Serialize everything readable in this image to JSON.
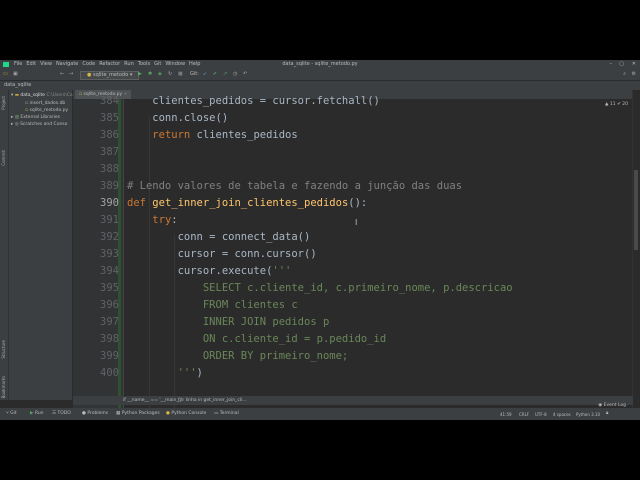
{
  "window": {
    "title": "data_sqlite - sqlite_metodo.py"
  },
  "menu": [
    "File",
    "Edit",
    "View",
    "Navigate",
    "Code",
    "Refactor",
    "Run",
    "Tools",
    "Git",
    "Window",
    "Help"
  ],
  "toolbar": {
    "run_config": "sqlite_metodo",
    "git_label": "Git:"
  },
  "navbar": {
    "project": "data_sqlite"
  },
  "left_tools": {
    "project": "Project",
    "commit": "Commit",
    "structure": "Structure",
    "bookmarks": "Bookmarks"
  },
  "project_tree": {
    "root": "data_sqlite",
    "root_path": "C:\\Users\\Ca",
    "files": [
      "insert_dados.db",
      "sqlite_metodo.py"
    ],
    "external": "External Libraries",
    "scratches": "Scratches and Conso"
  },
  "editor": {
    "tab": "sqlite_metodo.py",
    "inspection": "▲ 11  ✔ 20",
    "lines": [
      {
        "n": "384",
        "t": "    clientes_pedidos = cursor.fetchall()"
      },
      {
        "n": "385",
        "t": "    conn.close()"
      },
      {
        "n": "386",
        "t": "    return clientes_pedidos"
      },
      {
        "n": "387",
        "t": ""
      },
      {
        "n": "388",
        "t": ""
      },
      {
        "n": "389",
        "t": "# Lendo valores de tabela e fazendo a junção das duas"
      },
      {
        "n": "390",
        "t": "def get_inner_join_clientes_pedidos():"
      },
      {
        "n": "391",
        "t": "    try:"
      },
      {
        "n": "392",
        "t": "        conn = connect_data()"
      },
      {
        "n": "393",
        "t": "        cursor = conn.cursor()"
      },
      {
        "n": "394",
        "t": "        cursor.execute('''"
      },
      {
        "n": "395",
        "t": "            SELECT c.cliente_id, c.primeiro_nome, p.descricao"
      },
      {
        "n": "396",
        "t": "            FROM clientes c"
      },
      {
        "n": "397",
        "t": "            INNER JOIN pedidos p"
      },
      {
        "n": "398",
        "t": "            ON c.cliente_id = p.pedido_id"
      },
      {
        "n": "399",
        "t": "            ORDER BY primeiro_nome;"
      },
      {
        "n": "400",
        "t": "        ''')"
      }
    ],
    "breadcrumb_1": "if __name__ == '__main__'",
    "breadcrumb_2": "for linha in get_inner_join_cli..."
  },
  "bottom_tools": [
    "Git",
    "Run",
    "TODO",
    "Problems",
    "Python Packages",
    "Python Console",
    "Terminal"
  ],
  "event_log": "Event Log",
  "status": {
    "position": "41:59",
    "line_sep": "CRLF",
    "encoding": "UTF-8",
    "indent": "4 spaces",
    "interpreter": "Python 3.10"
  }
}
